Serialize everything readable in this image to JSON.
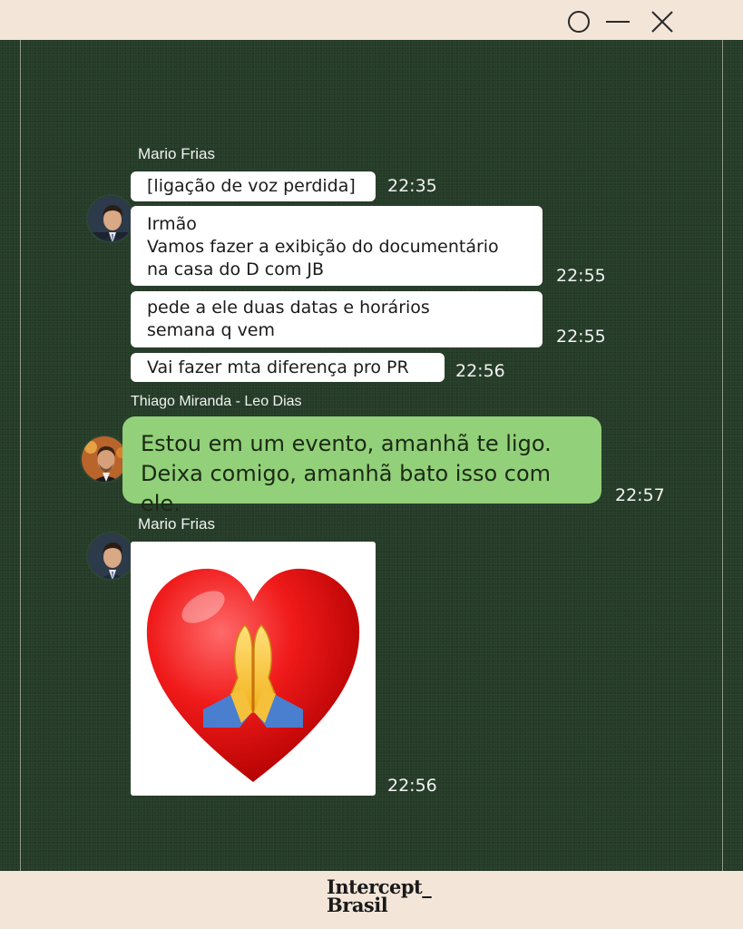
{
  "chat": {
    "group1": {
      "sender": "Mario Frias",
      "messages": [
        {
          "text": "[ligação de voz perdida]",
          "time": "22:35"
        },
        {
          "text": "Irmão\nVamos fazer a exibição do documentário\nna casa do D com JB",
          "time": "22:55"
        },
        {
          "text": "pede a ele duas datas e horários\nsemana q vem",
          "time": "22:55"
        },
        {
          "text": "Vai fazer mta diferença pro PR",
          "time": "22:56"
        }
      ]
    },
    "group2": {
      "sender": "Thiago Miranda - Leo Dias",
      "messages": [
        {
          "text": "Estou em um evento, amanhã te ligo.\nDeixa comigo, amanhã bato isso com ele.",
          "time": "22:57"
        }
      ]
    },
    "group3": {
      "sender": "Mario Frias",
      "sticker": {
        "icon": "heart-praying-hands-sticker",
        "time": "22:56"
      }
    }
  },
  "footer": {
    "brand_line1": "Intercept_",
    "brand_line2": "Brasil"
  },
  "colors": {
    "chat_bg": "#253c28",
    "frame": "#f3e6d8",
    "sent_bubble": "#92d07a",
    "received_bubble": "#ffffff"
  },
  "window_controls": [
    "circle-icon",
    "minimize-icon",
    "close-icon"
  ]
}
